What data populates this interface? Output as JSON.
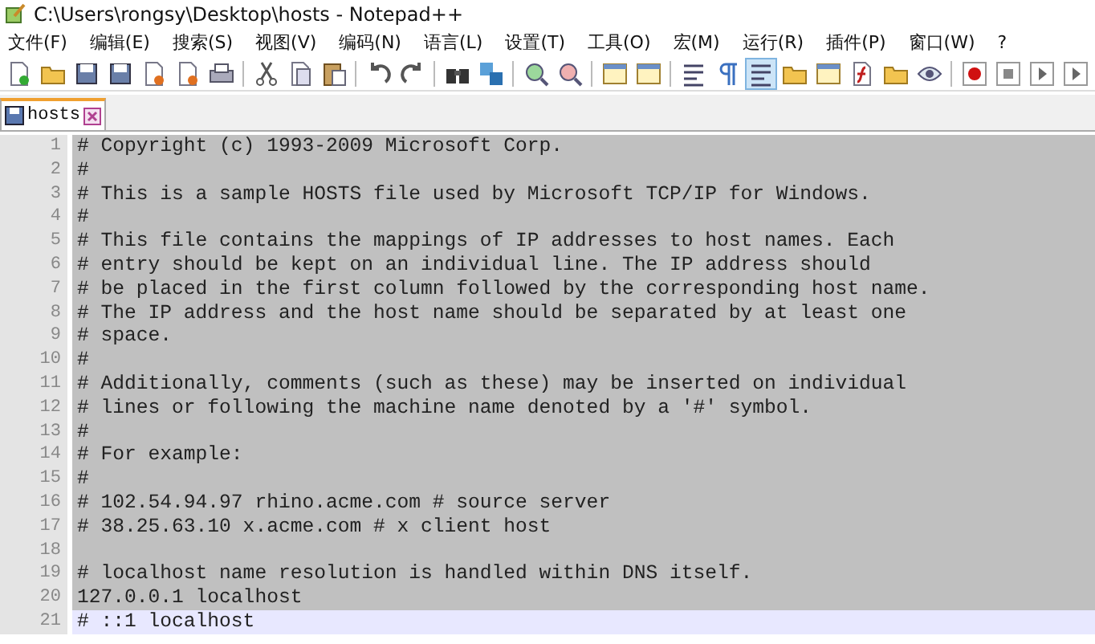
{
  "window": {
    "title": "C:\\Users\\rongsy\\Desktop\\hosts - Notepad++"
  },
  "menu": [
    "文件(F)",
    "编辑(E)",
    "搜索(S)",
    "视图(V)",
    "编码(N)",
    "语言(L)",
    "设置(T)",
    "工具(O)",
    "宏(M)",
    "运行(R)",
    "插件(P)",
    "窗口(W)",
    "?"
  ],
  "toolbar": [
    {
      "kind": "new",
      "pressed": false
    },
    {
      "kind": "open",
      "pressed": false
    },
    {
      "kind": "save",
      "pressed": false
    },
    {
      "kind": "save-all",
      "pressed": false
    },
    {
      "kind": "close",
      "pressed": false
    },
    {
      "kind": "close-all",
      "pressed": false
    },
    {
      "kind": "print",
      "pressed": false
    },
    {
      "kind": "separator"
    },
    {
      "kind": "cut",
      "pressed": false
    },
    {
      "kind": "copy",
      "pressed": false
    },
    {
      "kind": "paste",
      "pressed": false
    },
    {
      "kind": "separator"
    },
    {
      "kind": "undo",
      "pressed": false
    },
    {
      "kind": "redo",
      "pressed": false
    },
    {
      "kind": "separator"
    },
    {
      "kind": "find",
      "pressed": false
    },
    {
      "kind": "replace",
      "pressed": false
    },
    {
      "kind": "separator"
    },
    {
      "kind": "zoom-in",
      "pressed": false
    },
    {
      "kind": "zoom-out",
      "pressed": false
    },
    {
      "kind": "separator"
    },
    {
      "kind": "window",
      "pressed": false
    },
    {
      "kind": "window",
      "pressed": false
    },
    {
      "kind": "separator"
    },
    {
      "kind": "wrap",
      "pressed": false
    },
    {
      "kind": "pilcrow",
      "pressed": false
    },
    {
      "kind": "indent",
      "pressed": true
    },
    {
      "kind": "folder",
      "pressed": false
    },
    {
      "kind": "map",
      "pressed": false
    },
    {
      "kind": "function",
      "pressed": false
    },
    {
      "kind": "folder",
      "pressed": false
    },
    {
      "kind": "eye",
      "pressed": false
    },
    {
      "kind": "separator"
    },
    {
      "kind": "record",
      "pressed": false
    },
    {
      "kind": "stop",
      "pressed": false
    },
    {
      "kind": "play",
      "pressed": false
    },
    {
      "kind": "play-multi",
      "pressed": false
    }
  ],
  "tabs": [
    {
      "label": "hosts",
      "selected": true
    }
  ],
  "lines": [
    {
      "number": "1",
      "text": "# Copyright (c) 1993-2009 Microsoft Corp.",
      "selected": true,
      "current": false
    },
    {
      "number": "2",
      "text": "#",
      "selected": true,
      "current": false
    },
    {
      "number": "3",
      "text": "# This is a sample HOSTS file used by Microsoft TCP/IP for Windows.",
      "selected": true,
      "current": false
    },
    {
      "number": "4",
      "text": "#",
      "selected": true,
      "current": false
    },
    {
      "number": "5",
      "text": "# This file contains the mappings of IP addresses to host names. Each",
      "selected": true,
      "current": false
    },
    {
      "number": "6",
      "text": "# entry should be kept on an individual line. The IP address should",
      "selected": true,
      "current": false
    },
    {
      "number": "7",
      "text": "# be placed in the first column followed by the corresponding host name.",
      "selected": true,
      "current": false
    },
    {
      "number": "8",
      "text": "# The IP address and the host name should be separated by at least one",
      "selected": true,
      "current": false
    },
    {
      "number": "9",
      "text": "# space.",
      "selected": true,
      "current": false
    },
    {
      "number": "10",
      "text": "#",
      "selected": true,
      "current": false
    },
    {
      "number": "11",
      "text": "# Additionally, comments (such as these) may be inserted on individual",
      "selected": true,
      "current": false
    },
    {
      "number": "12",
      "text": "# lines or following the machine name denoted by a '#' symbol.",
      "selected": true,
      "current": false
    },
    {
      "number": "13",
      "text": "#",
      "selected": true,
      "current": false
    },
    {
      "number": "14",
      "text": "# For example:",
      "selected": true,
      "current": false
    },
    {
      "number": "15",
      "text": "#",
      "selected": true,
      "current": false
    },
    {
      "number": "16",
      "text": "# 102.54.94.97 rhino.acme.com # source server",
      "selected": true,
      "current": false
    },
    {
      "number": "17",
      "text": "# 38.25.63.10 x.acme.com # x client host",
      "selected": true,
      "current": false
    },
    {
      "number": "18",
      "selected": true,
      "current": false
    },
    {
      "number": "19",
      "text": "# localhost name resolution is handled within DNS itself.",
      "selected": true,
      "current": false
    },
    {
      "number": "20",
      "text": "127.0.0.1 localhost",
      "selected": true,
      "current": false
    },
    {
      "number": "21",
      "text": "# ::1 localhost",
      "selected": false,
      "current": true
    }
  ]
}
